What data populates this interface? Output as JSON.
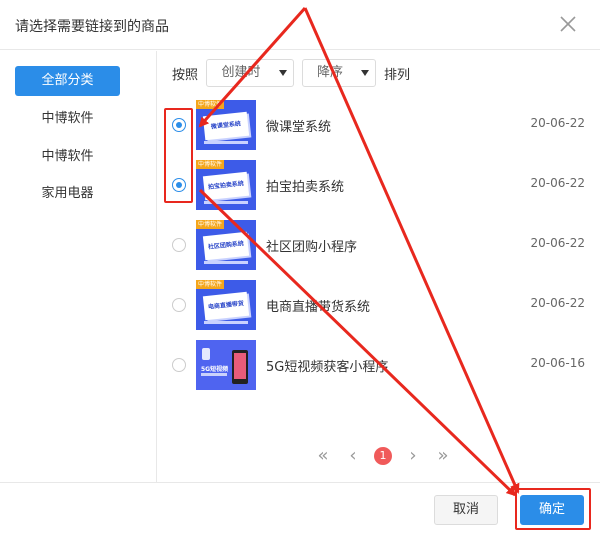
{
  "dialog": {
    "title": "请选择需要链接到的商品"
  },
  "sidebar": {
    "items": [
      {
        "label": "全部分类",
        "active": true
      },
      {
        "label": "中博软件",
        "active": false
      },
      {
        "label": "中博软件",
        "active": false
      },
      {
        "label": "家用电器",
        "active": false
      }
    ]
  },
  "sort": {
    "prefix": "按照",
    "field": "创建时",
    "order": "降序",
    "suffix": "排列"
  },
  "products": [
    {
      "name": "微课堂系统",
      "date": "20-06-22",
      "checked": true,
      "thumb_tag": "中博软件",
      "thumb_text": "微课堂系统"
    },
    {
      "name": "拍宝拍卖系统",
      "date": "20-06-22",
      "checked": true,
      "thumb_tag": "中博软件",
      "thumb_text": "拍宝拍卖系统"
    },
    {
      "name": "社区团购小程序",
      "date": "20-06-22",
      "checked": false,
      "thumb_tag": "中博软件",
      "thumb_text": "社区团购系统"
    },
    {
      "name": "电商直播带货系统",
      "date": "20-06-22",
      "checked": false,
      "thumb_tag": "中博软件",
      "thumb_text": "电商直播带货"
    },
    {
      "name": "5G短视频获客小程序",
      "date": "20-06-16",
      "checked": false,
      "thumb_tag": "",
      "thumb_text": "5G短视频"
    }
  ],
  "pager": {
    "first": "«",
    "prev": "‹",
    "current": "1",
    "next": "›",
    "last": "»"
  },
  "footer": {
    "cancel_label": "取消",
    "ok_label": "确定"
  },
  "colors": {
    "accent": "#2b8de8",
    "annotation": "#e8281e",
    "pager_current": "#f05a5a"
  },
  "icons": {
    "close": "close-icon"
  }
}
